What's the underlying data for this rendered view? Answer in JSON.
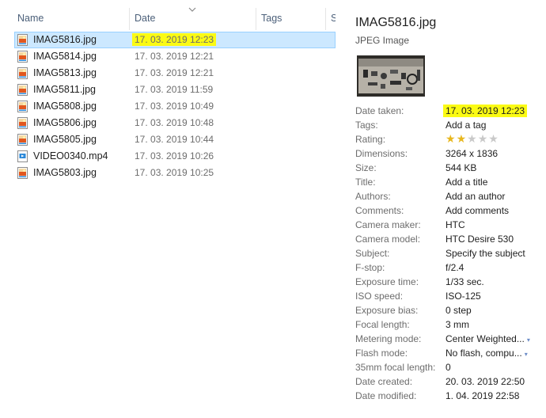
{
  "columns": {
    "name": "Name",
    "date": "Date",
    "tags": "Tags",
    "size_partial": "S"
  },
  "files": [
    {
      "name": "IMAG5816.jpg",
      "date": "17. 03. 2019 12:23",
      "type": "image",
      "selected": true,
      "highlighted": true
    },
    {
      "name": "IMAG5814.jpg",
      "date": "17. 03. 2019 12:21",
      "type": "image"
    },
    {
      "name": "IMAG5813.jpg",
      "date": "17. 03. 2019 12:21",
      "type": "image"
    },
    {
      "name": "IMAG5811.jpg",
      "date": "17. 03. 2019 11:59",
      "type": "image"
    },
    {
      "name": "IMAG5808.jpg",
      "date": "17. 03. 2019 10:49",
      "type": "image"
    },
    {
      "name": "IMAG5806.jpg",
      "date": "17. 03. 2019 10:48",
      "type": "image"
    },
    {
      "name": "IMAG5805.jpg",
      "date": "17. 03. 2019 10:44",
      "type": "image"
    },
    {
      "name": "VIDEO0340.mp4",
      "date": "17. 03. 2019 10:26",
      "type": "video"
    },
    {
      "name": "IMAG5803.jpg",
      "date": "17. 03. 2019 10:25",
      "type": "image"
    }
  ],
  "details": {
    "title": "IMAG5816.jpg",
    "type": "JPEG Image",
    "rating_value": 2,
    "rating_max": 5,
    "properties": [
      {
        "label": "Date taken:",
        "value": "17. 03. 2019 12:23",
        "highlight": true
      },
      {
        "label": "Tags:",
        "value": "Add a tag",
        "link": true
      },
      {
        "label": "Rating:",
        "value": "",
        "stars": true
      },
      {
        "label": "Dimensions:",
        "value": "3264 x 1836"
      },
      {
        "label": "Size:",
        "value": "544 KB"
      },
      {
        "label": "Title:",
        "value": "Add a title",
        "link": true
      },
      {
        "label": "Authors:",
        "value": "Add an author",
        "link": true
      },
      {
        "label": "Comments:",
        "value": "Add comments",
        "link": true
      },
      {
        "label": "Camera maker:",
        "value": "HTC"
      },
      {
        "label": "Camera model:",
        "value": "HTC Desire 530"
      },
      {
        "label": "Subject:",
        "value": "Specify the subject",
        "link": true
      },
      {
        "label": "F-stop:",
        "value": "f/2.4"
      },
      {
        "label": "Exposure time:",
        "value": "1/33 sec."
      },
      {
        "label": "ISO speed:",
        "value": "ISO-125"
      },
      {
        "label": "Exposure bias:",
        "value": "0 step"
      },
      {
        "label": "Focal length:",
        "value": "3 mm"
      },
      {
        "label": "Metering mode:",
        "value": "Center Weighted...",
        "dropdown": true
      },
      {
        "label": "Flash mode:",
        "value": "No flash, compu...",
        "dropdown": true
      },
      {
        "label": "35mm focal length:",
        "value": "0"
      },
      {
        "label": "Date created:",
        "value": "20. 03. 2019 22:50"
      },
      {
        "label": "Date modified:",
        "value": "1. 04. 2019 22:58"
      }
    ]
  },
  "colors": {
    "selection": "#cce8ff",
    "highlight": "#fbfb14",
    "header_text": "#4c607a"
  },
  "icons": {
    "image": "image-file-icon",
    "video": "video-file-icon",
    "sort": "chevron-down-icon",
    "dropdown": "chevron-down-icon",
    "star": "star-icon"
  }
}
